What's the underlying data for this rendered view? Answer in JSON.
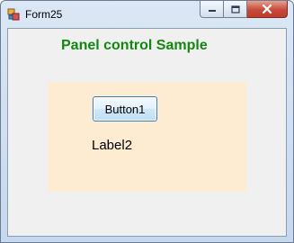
{
  "window": {
    "title": "Form25",
    "icon": "app-form-icon",
    "controls": {
      "minimize_icon": "minimize-icon",
      "maximize_icon": "maximize-icon",
      "close_icon": "close-icon"
    }
  },
  "form": {
    "heading": "Panel control Sample",
    "heading_color": "#13870f",
    "panel": {
      "background_color": "#fdebd2",
      "button_label": "Button1",
      "label_text": "Label2"
    }
  }
}
